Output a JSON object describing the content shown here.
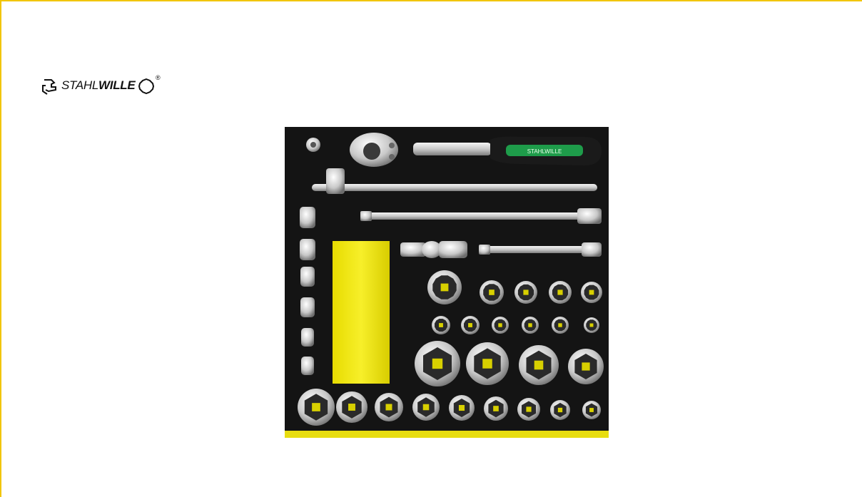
{
  "brand": {
    "name_light": "STAHL",
    "name_bold": "WILLE",
    "registered": "®",
    "logo_icon": "wrench-jaw-icon",
    "nut_icon": "twelve-point-nut-icon"
  },
  "tray": {
    "ratchet_handle_text": "STAHLWILLE",
    "foam_color": "#111111",
    "accent_color": "#f2e600",
    "handle_green": "#1e9c4a"
  },
  "colors": {
    "frame_yellow": "#f2c500",
    "chrome_light": "#e6e6e6",
    "chrome_dark": "#8a8a8a"
  }
}
